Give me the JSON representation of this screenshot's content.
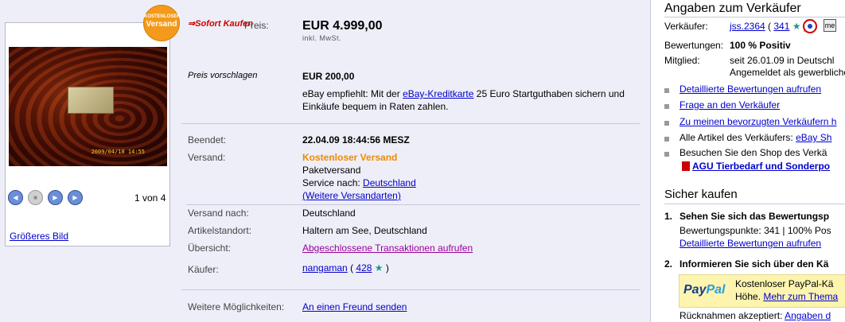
{
  "gallery": {
    "badge_line1": "KOSTENLOSER",
    "badge_line2": "Versand",
    "photo_stamp": "2009/04/18 14:55",
    "counter": "1 von 4",
    "bigger_link": "Größeres Bild"
  },
  "price": {
    "buy_now_brand": "Sofort Kaufen",
    "label": "Preis:",
    "value": "EUR 4.999,00",
    "vat": "inkl. MwSt.",
    "offer_label": "Preis vorschlagen",
    "offer_value": "EUR 200,00",
    "credit_pre": "eBay empfiehlt: Mit der ",
    "credit_link": "eBay-Kreditkarte",
    "credit_post": " 25 Euro Startguthaben sichern und Einkäufe bequem in Raten zahlen."
  },
  "details": {
    "ended_label": "Beendet:",
    "ended_value": "22.04.09 18:44:56 MESZ",
    "shipping_label": "Versand:",
    "shipping_free": "Kostenloser Versand",
    "shipping_type": "Paketversand",
    "service_pre": "Service nach: ",
    "service_link": "Deutschland",
    "more_shipping": "(Weitere Versandarten)",
    "ship_to_label": "Versand nach:",
    "ship_to_value": "Deutschland",
    "location_label": "Artikelstandort:",
    "location_value": "Haltern am See, Deutschland",
    "overview_label": "Übersicht:",
    "overview_link": "Abgeschlossene Transaktionen aufrufen",
    "buyer_label": "Käufer:",
    "buyer_name": "nangaman",
    "buyer_open": "( ",
    "buyer_score": "428",
    "buyer_close": " )",
    "more_label": "Weitere Möglichkeiten:",
    "more_link": "An einen Freund senden"
  },
  "seller": {
    "heading": "Angaben zum Verkäufer",
    "seller_label": "Verkäufer:",
    "seller_name": "jss.2364",
    "seller_open": " ( ",
    "seller_score": "341",
    "seller_close": " )",
    "rating_label": "Bewertungen:",
    "rating_value": "100 % Positiv",
    "member_label": "Mitglied:",
    "member_value": "seit 26.01.09 in Deutschl",
    "member_value2": "Angemeldet als gewerbliche",
    "link1": "Detaillierte Bewertungen aufrufen",
    "link2": "Frage an den Verkäufer",
    "link3": "Zu meinen bevorzugten Verkäufern h",
    "all_items_pre": "Alle Artikel des Verkäufers: ",
    "all_items_link": "eBay Sh",
    "shop_text": "Besuchen Sie den Shop des Verkä",
    "shop_link": "AGU Tierbedarf und Sonderpo"
  },
  "safe": {
    "heading": "Sicher kaufen",
    "step1_num": "1.",
    "step1_title": "Sehen Sie sich das Bewertungsp",
    "step1_detail": "Bewertungspunkte: 341 | 100% Pos",
    "step1_link": "Detaillierte Bewertungen aufrufen",
    "step2_num": "2.",
    "step2_title": "Informieren Sie sich über den Kä",
    "paypal_pay": "Pay",
    "paypal_pal": "Pal",
    "paypal_line1": "Kostenloser PayPal-Kä",
    "paypal_line2_pre": "Höhe. ",
    "paypal_link": "Mehr zum Thema",
    "returns_label": "Rücknahmen akzeptiert: ",
    "returns_link": "Angaben d"
  }
}
